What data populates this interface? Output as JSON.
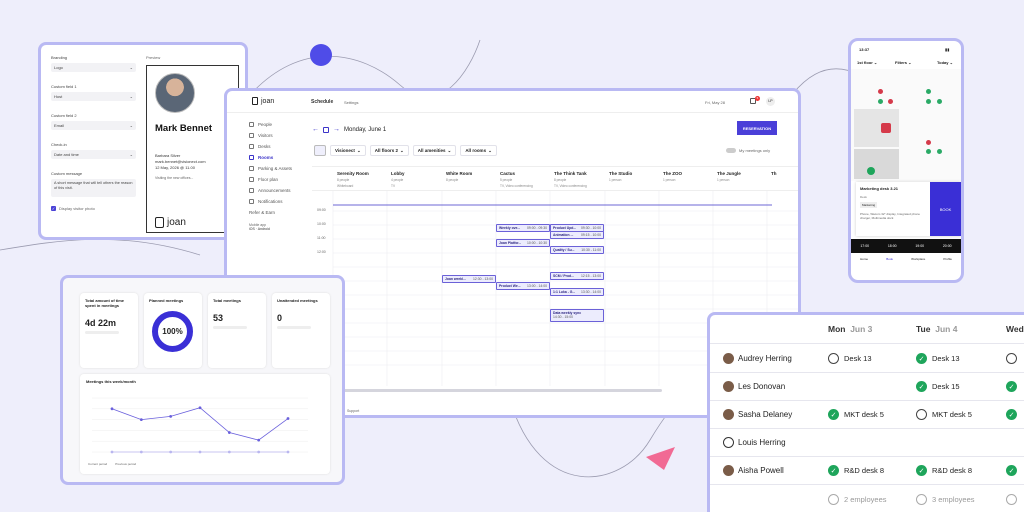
{
  "profile_card": {
    "branding_label": "Branding",
    "branding_value": "Logo",
    "field1_label": "Custom field 1",
    "field1_value": "Host",
    "field2_label": "Custom field 2",
    "field2_value": "Email",
    "checkin_label": "Check-in",
    "checkin_value": "Date and time",
    "message_label": "Custom message",
    "message_value": "A short message that will tell others the reason of this visit.",
    "photo_label": "Display visitor photo",
    "preview_label": "Preview",
    "name": "Mark Bennet",
    "host": "Barbara Silver",
    "email": "mark.bennet@visionect.com",
    "date": "12 May, 2026 @ 11.00",
    "note": "Visiting the new offices...",
    "logo_text": "joan"
  },
  "schedule": {
    "logo": "joan",
    "tab_schedule": "Schedule",
    "tab_settings": "Settings",
    "date_top": "Fri, May 28",
    "user_initials": "LP",
    "notif_count": "5",
    "nav": [
      "People",
      "Visitors",
      "Desks",
      "Rooms",
      "Parking & Assets",
      "Floor plan",
      "Announcements",
      "Notifications",
      "Refer & Earn"
    ],
    "mobile_app_label": "Mobile app",
    "mobile_app_value": "iOS · Android",
    "date": "Monday, June 1",
    "reserve_button": "RESERVATION",
    "filters": [
      "Visionect",
      "All floors 2",
      "All amenities",
      "All rooms"
    ],
    "toggle_label": "My meetings only",
    "rooms": [
      {
        "name": "Serenity Room",
        "cap": "8 people",
        "extra": "Whiteboard"
      },
      {
        "name": "Lobby",
        "cap": "4 people",
        "extra": "TV"
      },
      {
        "name": "White Room",
        "cap": "8 people",
        "extra": ""
      },
      {
        "name": "Cactus",
        "cap": "5 people",
        "extra": "TV, Video conferencing"
      },
      {
        "name": "The Think Tank",
        "cap": "8 people",
        "extra": "TV, Video conferencing"
      },
      {
        "name": "The Studio",
        "cap": "1 person",
        "extra": ""
      },
      {
        "name": "The ZOO",
        "cap": "1 person",
        "extra": ""
      },
      {
        "name": "The Jungle",
        "cap": "1 person",
        "extra": ""
      },
      {
        "name": "Th",
        "cap": "",
        "extra": ""
      }
    ],
    "times": [
      "09:00",
      "10:00",
      "11:00",
      "12:00"
    ],
    "events": [
      {
        "title": "Weekly ove...",
        "time": "09:00 - 09:30"
      },
      {
        "title": "Product Upd...",
        "time": "09:30 - 10:00"
      },
      {
        "title": "Animation ...",
        "time": "09:15 - 10:00"
      },
      {
        "title": "Joan Platfor...",
        "time": "10:00 - 10:30"
      },
      {
        "title": "Quality / Su...",
        "time": "10:30 - 11:00"
      },
      {
        "title": "Joan weekl...",
        "time": "12:30 - 13:00"
      },
      {
        "title": "SCM / Prod...",
        "time": "12:15 - 13:00"
      },
      {
        "title": "Product We...",
        "time": "13:00 - 14:00"
      },
      {
        "title": "1:1 Luka - G...",
        "time": "13:30 - 14:00"
      },
      {
        "title": "Data weekly sync",
        "time": "14:30 - 15:00"
      }
    ],
    "footer": "Support"
  },
  "stats": {
    "cards": [
      {
        "title": "Total amount of time spent in meetings",
        "value": "4d 22m"
      },
      {
        "title": "Planned meetings",
        "value": "100%"
      },
      {
        "title": "Total meetings",
        "value": "53"
      },
      {
        "title": "Unattended meetings",
        "value": "0"
      }
    ],
    "chart_title": "Meetings this week/month",
    "legend": [
      "Current period",
      "Previous period"
    ]
  },
  "chart_data": {
    "type": "line",
    "title": "Meetings this week/month",
    "series": [
      {
        "name": "Current period",
        "values": [
          4,
          3,
          3.3,
          4.1,
          1.8,
          1.1,
          3.1
        ]
      },
      {
        "name": "Previous period",
        "values": [
          0,
          0,
          0,
          0,
          0,
          0,
          0
        ]
      }
    ],
    "ylim": [
      0,
      5
    ]
  },
  "attendance": {
    "days": [
      {
        "day": "Mon",
        "date": "Jun 3"
      },
      {
        "day": "Tue",
        "date": "Jun 4"
      },
      {
        "day": "Wed",
        "date": ""
      }
    ],
    "rows": [
      {
        "name": "Audrey Herring",
        "mon": "Desk 13",
        "mon_checked": false,
        "tue": "Desk 13",
        "tue_checked": true,
        "wed_checked": false
      },
      {
        "name": "Les Donovan",
        "mon": "",
        "mon_checked": null,
        "tue": "Desk 15",
        "tue_checked": true,
        "wed_checked": true
      },
      {
        "name": "Sasha Delaney",
        "mon": "MKT desk 5",
        "mon_checked": true,
        "tue": "MKT desk 5",
        "tue_checked": false,
        "wed_checked": true
      },
      {
        "name": "Louis Herring",
        "mon": "",
        "mon_checked": null,
        "tue": "",
        "tue_checked": null,
        "wed_checked": null
      },
      {
        "name": "Aisha Powell",
        "mon": "R&D desk 8",
        "mon_checked": true,
        "tue": "R&D desk 8",
        "tue_checked": true,
        "wed_checked": true
      }
    ],
    "summary_mon": "2 employees",
    "summary_tue": "3 employees"
  },
  "mobile": {
    "time": "13:37",
    "floor": "1st floor",
    "filters": "Filters",
    "day": "Today",
    "desk_title": "Marketing desk 3.21",
    "desk_type": "Desk",
    "desk_tag": "Marketing",
    "desk_amenities": "Phone, Wacom 32\" display, Integrated phone charger, Multimedia dock",
    "book_button": "BOOK",
    "slots": [
      "17:00",
      "18:00",
      "19:00",
      "20:00"
    ],
    "tabs": [
      "Home",
      "Book",
      "Workplace",
      "Profile"
    ]
  }
}
